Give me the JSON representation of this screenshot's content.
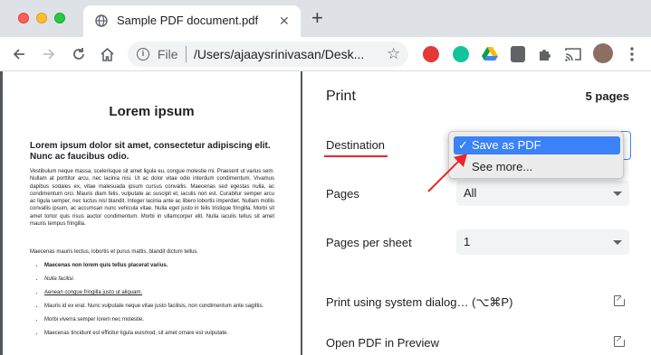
{
  "browser": {
    "tab_title": "Sample PDF document.pdf",
    "tab_close": "✕",
    "new_tab": "+",
    "omnibox": {
      "scheme_label": "File",
      "url": "/Users/ajaaysrinivasan/Desk..."
    }
  },
  "preview": {
    "title": "Lorem ipsum",
    "subtitle": "Lorem ipsum dolor sit amet, consectetur adipiscing elit. Nunc ac faucibus odio.",
    "para1": "Vestibulum neque massa, scelerisque sit amet ligula eu, congue molestie mi. Praesent ut varius sem. Nullam at porttitor arcu, nec lacinia nisi. Ut ac dolor vitae odio interdum condimentum. Vivamus dapibus sodales ex, vitae malesuada ipsum cursus convallis. Maecenas sed egestas nulla, ac condimentum orci. Mauris diam felis, vulputate ac suscipit et, iaculis non est. Curabitur semper arcu ac ligula semper, nec luctus nisl blandit. Integer lacinia ante ac libero lobortis imperdiet. Nullam mollis convallis ipsum, ac accumsan nunc vehicula vitae. Nulla eget justo in felis tristique fringilla. Morbi sit amet tortor quis risus auctor condimentum. Morbi in ullamcorper elit. Nulla iaculis tellus sit amet mauris tempus fringilla.",
    "para2": "Maecenas mauris lectus, lobortis et purus mattis, blandit dictum tellus.",
    "list": [
      "Maecenas non lorem quis tellus placerat varius.",
      "Nulla facilisi.",
      "Aenean congue fringilla justo ut aliquam.",
      "Mauris id ex erat. Nunc vulputate neque vitae justo facilisis, non condimentum ante sagittis.",
      "Morbi viverra semper lorem nec molestie.",
      "Maecenas tincidunt est efficitur ligula euismod, sit amet ornare est vulputate."
    ]
  },
  "settings": {
    "title": "Print",
    "pages_count": "5 pages",
    "destination_label": "Destination",
    "pages_label": "Pages",
    "pages_value": "All",
    "pages_per_sheet_label": "Pages per sheet",
    "pages_per_sheet_value": "1",
    "system_dialog_label": "Print using system dialog… (⌥⌘P)",
    "open_preview_label": "Open PDF in Preview"
  },
  "destination_popup": {
    "selected_check": "✓",
    "selected_option": "Save as PDF",
    "other_option": "See more..."
  },
  "colors": {
    "annotation_red": "#e8262b",
    "highlight_blue": "#3a82f6"
  }
}
